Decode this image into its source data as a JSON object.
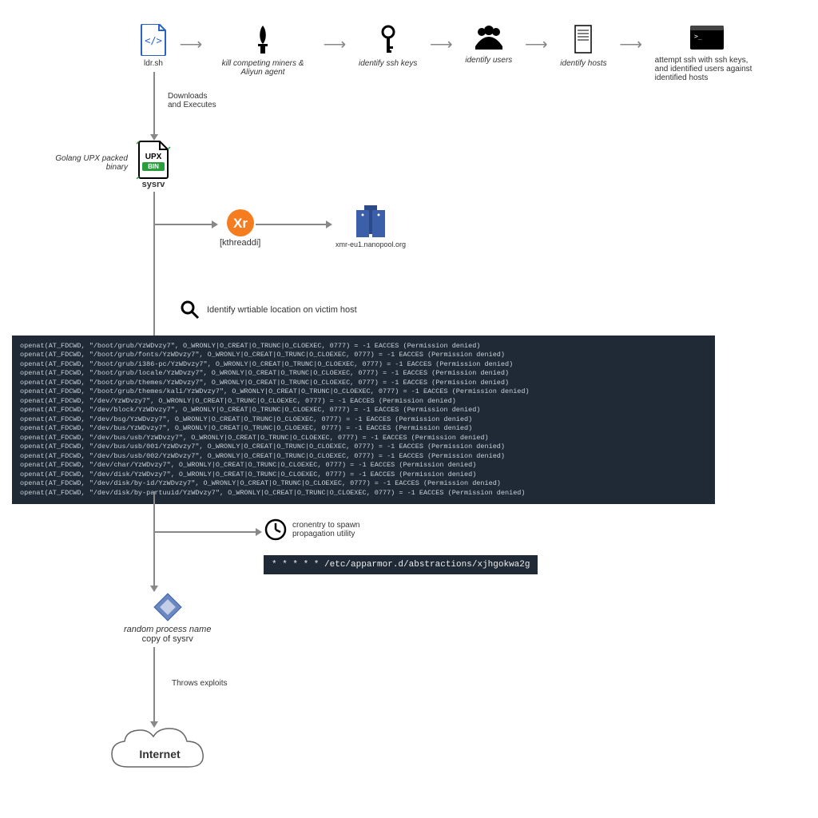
{
  "top_row": {
    "ldr": "ldr.sh",
    "kill": "kill competing miners & Aliyun agent",
    "ssh_keys": "identify ssh keys",
    "users": "identify users",
    "hosts": "identify hosts",
    "attempt": "attempt ssh with ssh keys, and identified users against identified hosts"
  },
  "downloads": {
    "line1": "Downloads",
    "line2": "and Executes"
  },
  "golang": "Golang UPX packed binary",
  "sysrv": "sysrv",
  "upx": "UPX",
  "bin": "BIN",
  "kthreaddi": "[kthreaddi]",
  "nanopool": "xmr-eu1.nanopool.org",
  "writable": "Identify wrtiable location on victim host",
  "terminal_lines": [
    "openat(AT_FDCWD, \"/boot/grub/YzWDvzy7\", O_WRONLY|O_CREAT|O_TRUNC|O_CLOEXEC, 0777) = -1 EACCES (Permission denied)",
    "openat(AT_FDCWD, \"/boot/grub/fonts/YzWDvzy7\", O_WRONLY|O_CREAT|O_TRUNC|O_CLOEXEC, 0777) = -1 EACCES (Permission denied)",
    "openat(AT_FDCWD, \"/boot/grub/i386-pc/YzWDvzy7\", O_WRONLY|O_CREAT|O_TRUNC|O_CLOEXEC, 0777) = -1 EACCES (Permission denied)",
    "openat(AT_FDCWD, \"/boot/grub/locale/YzWDvzy7\", O_WRONLY|O_CREAT|O_TRUNC|O_CLOEXEC, 0777) = -1 EACCES (Permission denied)",
    "openat(AT_FDCWD, \"/boot/grub/themes/YzWDvzy7\", O_WRONLY|O_CREAT|O_TRUNC|O_CLOEXEC, 0777) = -1 EACCES (Permission denied)",
    "openat(AT_FDCWD, \"/boot/grub/themes/kali/YzWDvzy7\", O_WRONLY|O_CREAT|O_TRUNC|O_CLOEXEC, 0777) = -1 EACCES (Permission denied)",
    "openat(AT_FDCWD, \"/dev/YzWDvzy7\", O_WRONLY|O_CREAT|O_TRUNC|O_CLOEXEC, 0777) = -1 EACCES (Permission denied)",
    "openat(AT_FDCWD, \"/dev/block/YzWDvzy7\", O_WRONLY|O_CREAT|O_TRUNC|O_CLOEXEC, 0777) = -1 EACCES (Permission denied)",
    "openat(AT_FDCWD, \"/dev/bsg/YzWDvzy7\", O_WRONLY|O_CREAT|O_TRUNC|O_CLOEXEC, 0777) = -1 EACCES (Permission denied)",
    "openat(AT_FDCWD, \"/dev/bus/YzWDvzy7\", O_WRONLY|O_CREAT|O_TRUNC|O_CLOEXEC, 0777) = -1 EACCES (Permission denied)",
    "openat(AT_FDCWD, \"/dev/bus/usb/YzWDvzy7\", O_WRONLY|O_CREAT|O_TRUNC|O_CLOEXEC, 0777) = -1 EACCES (Permission denied)",
    "openat(AT_FDCWD, \"/dev/bus/usb/001/YzWDvzy7\", O_WRONLY|O_CREAT|O_TRUNC|O_CLOEXEC, 0777) = -1 EACCES (Permission denied)",
    "openat(AT_FDCWD, \"/dev/bus/usb/002/YzWDvzy7\", O_WRONLY|O_CREAT|O_TRUNC|O_CLOEXEC, 0777) = -1 EACCES (Permission denied)",
    "openat(AT_FDCWD, \"/dev/char/YzWDvzy7\", O_WRONLY|O_CREAT|O_TRUNC|O_CLOEXEC, 0777) = -1 EACCES (Permission denied)",
    "openat(AT_FDCWD, \"/dev/disk/YzWDvzy7\", O_WRONLY|O_CREAT|O_TRUNC|O_CLOEXEC, 0777) = -1 EACCES (Permission denied)",
    "openat(AT_FDCWD, \"/dev/disk/by-id/YzWDvzy7\", O_WRONLY|O_CREAT|O_TRUNC|O_CLOEXEC, 0777) = -1 EACCES (Permission denied)",
    "openat(AT_FDCWD, \"/dev/disk/by-partuuid/YzWDvzy7\", O_WRONLY|O_CREAT|O_TRUNC|O_CLOEXEC, 0777) = -1 EACCES (Permission denied)"
  ],
  "cronentry": {
    "line1": "cronentry to spawn",
    "line2": "propagation utility"
  },
  "cron_content": "* * * * * /etc/apparmor.d/abstractions/xjhgokwa2g",
  "random_process": {
    "line1": "random process name",
    "line2": "copy of sysrv"
  },
  "throws": "Throws exploits",
  "internet": "Internet"
}
